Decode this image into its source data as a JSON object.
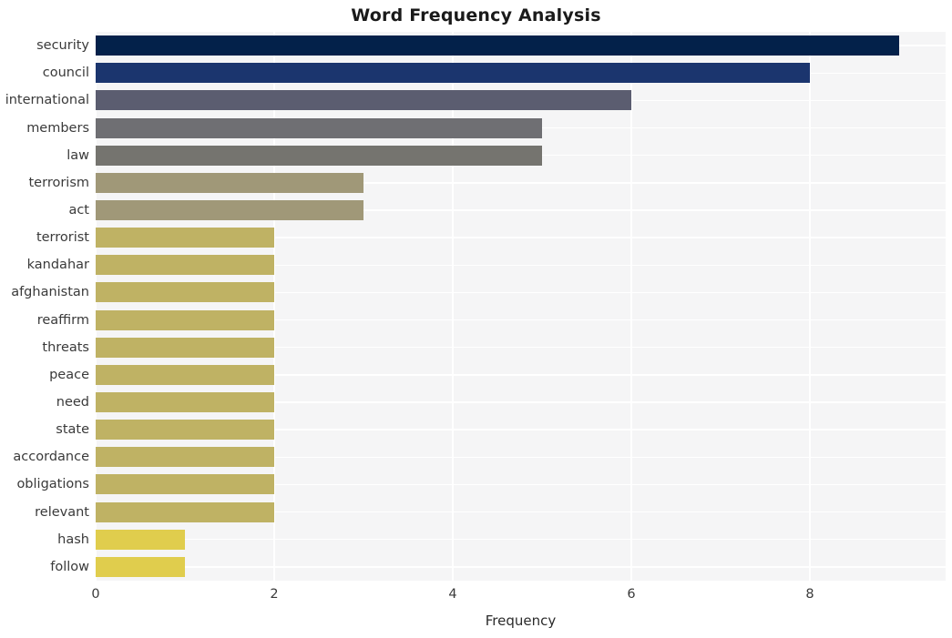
{
  "chart_data": {
    "type": "bar",
    "orientation": "horizontal",
    "title": "Word Frequency Analysis",
    "xlabel": "Frequency",
    "ylabel": "",
    "categories": [
      "security",
      "council",
      "international",
      "members",
      "law",
      "terrorism",
      "act",
      "terrorist",
      "kandahar",
      "afghanistan",
      "reaffirm",
      "threats",
      "peace",
      "need",
      "state",
      "accordance",
      "obligations",
      "relevant",
      "hash",
      "follow"
    ],
    "values": [
      9,
      8,
      6,
      5,
      5,
      3,
      3,
      2,
      2,
      2,
      2,
      2,
      2,
      2,
      2,
      2,
      2,
      2,
      1,
      1
    ],
    "bar_colors": [
      "#03214a",
      "#1b356e",
      "#5b5d70",
      "#6f6f73",
      "#75746f",
      "#a09878",
      "#a09878",
      "#bfb264",
      "#bfb264",
      "#bfb264",
      "#bfb264",
      "#bfb264",
      "#bfb264",
      "#bfb264",
      "#bfb264",
      "#bfb264",
      "#bfb264",
      "#bfb264",
      "#e0cd4d",
      "#e0cd4d"
    ],
    "xticks": [
      0,
      2,
      4,
      6,
      8
    ],
    "xtick_labels": [
      "0",
      "2",
      "4",
      "6",
      "8"
    ],
    "xlim": [
      0,
      9.52
    ],
    "grid": true,
    "grid_axis": "both",
    "legend": "none",
    "plot_background": "#f5f5f6",
    "figure_background": "#ffffff",
    "gridline_color": "#ffffff"
  }
}
